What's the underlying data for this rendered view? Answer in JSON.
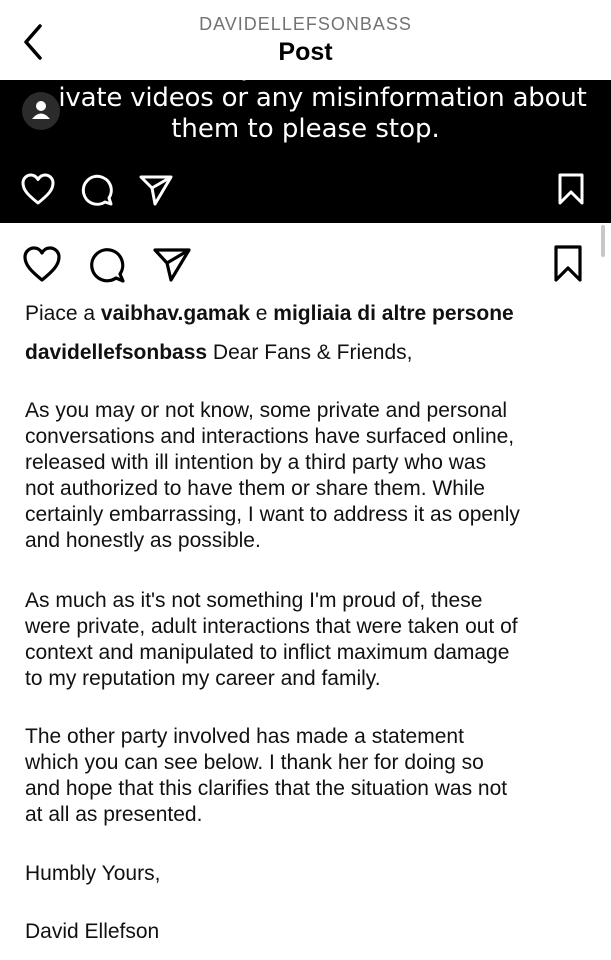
{
  "header": {
    "username": "DAVIDELLEFSONBASS",
    "title": "Post"
  },
  "image": {
    "line_top": "private videos or any misinformation about",
    "line_bottom": "them to please stop.",
    "line_top_visible": "ivate videos or any misinformation about"
  },
  "likes": {
    "prefix": "Piace a ",
    "user": "vaibhav.gamak",
    "middle": " e ",
    "others": "migliaia di altre persone"
  },
  "caption": {
    "username": "davidellefsonbass",
    "greeting": " Dear Fans & Friends,",
    "paragraphs": [
      [
        "As you may or not know, some private and personal",
        "conversations and interactions have surfaced online,",
        "released with ill intention by a third party who was",
        "not authorized to have them or share them. While",
        "certainly embarrassing, I want to address it as openly",
        "and honestly as possible."
      ],
      [
        "As much as it's not something I'm proud of, these",
        "were private, adult interactions that were taken out of",
        "context and manipulated to inflict maximum damage",
        "to my reputation my career and family."
      ],
      [
        "The other party involved has made a statement",
        "which you can see below.  I thank her for doing so",
        "and hope that this clarifies that the situation was not",
        "at all as presented."
      ],
      [
        "Humbly Yours,"
      ],
      [
        "David Ellefson"
      ]
    ]
  },
  "icons": {
    "back": "chevron-left-icon",
    "like": "heart-icon",
    "comment": "comment-icon",
    "share": "send-icon",
    "save": "bookmark-icon",
    "tag": "person-tag-icon"
  },
  "colors": {
    "username_gray": "#737373",
    "image_bg": "#000000"
  }
}
